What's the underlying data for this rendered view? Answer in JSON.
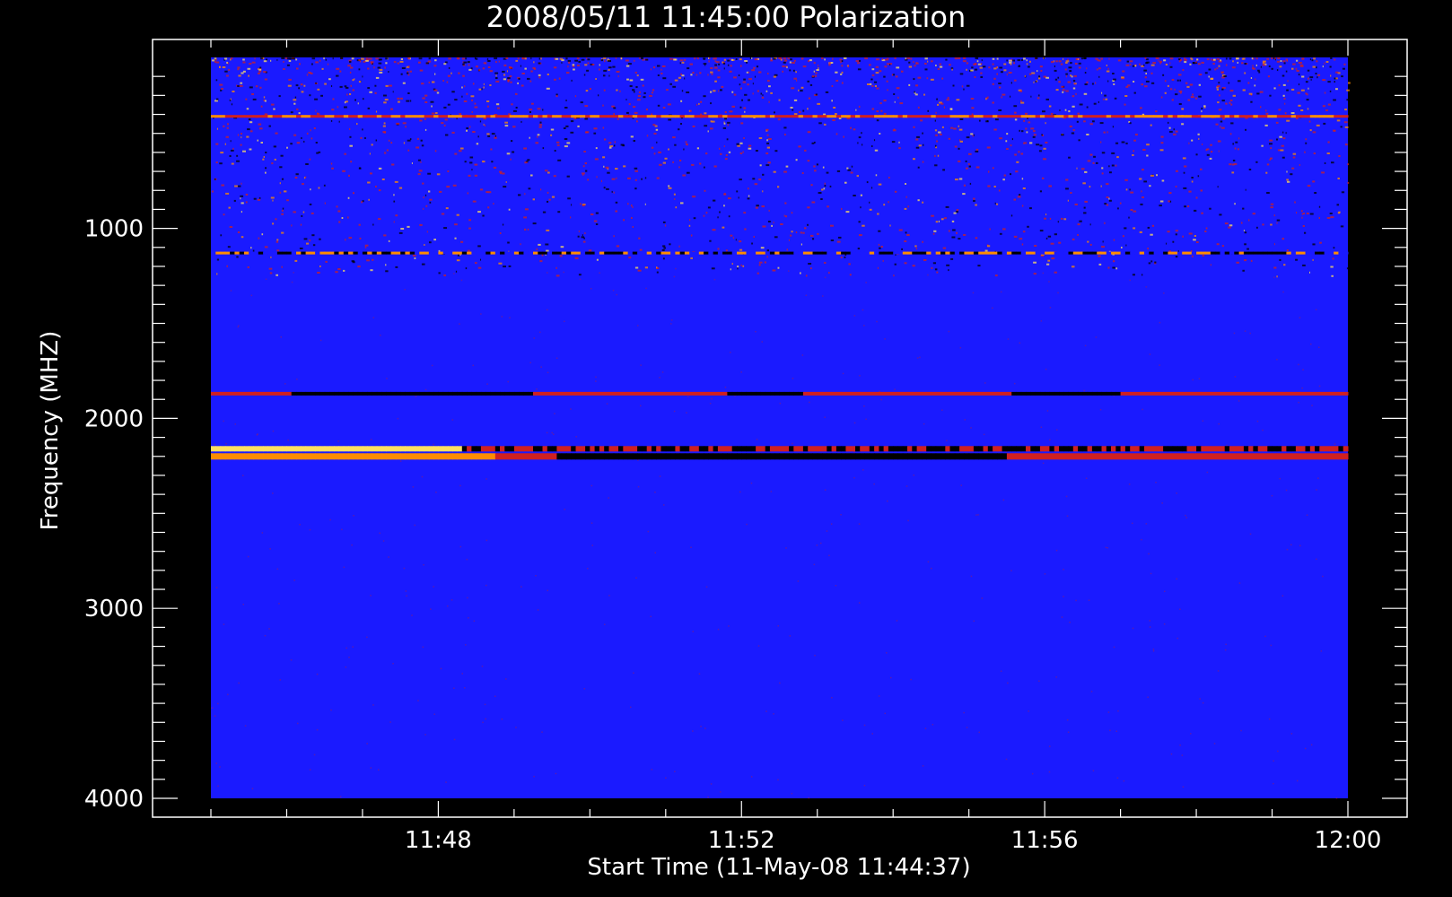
{
  "chart_data": {
    "type": "heatmap",
    "title": "2008/05/11 11:45:00 Polarization",
    "xlabel": "Start Time (11-May-08 11:44:37)",
    "ylabel": "Frequency (MHZ)",
    "xlim": [
      "11:45:00",
      "12:00:00"
    ],
    "ylim": [
      100,
      4000
    ],
    "y_axis_inverted": true,
    "x_tick_labels": [
      "11:48",
      "11:52",
      "11:56",
      "12:00"
    ],
    "y_tick_labels": [
      "1000",
      "2000",
      "3000",
      "4000"
    ],
    "background_color": "#1a1aff",
    "colormap": [
      "#000000",
      "#1a1aff",
      "#d02020",
      "#ff8c00",
      "#ffe060"
    ],
    "features": [
      {
        "description": "strong yellow-red band at start fading to dark band",
        "freq_mhz": [
          2160,
          2210
        ],
        "time": [
          "11:45:00",
          "12:00:00"
        ]
      },
      {
        "description": "thin red/dark line",
        "freq_mhz": 1870,
        "time": [
          "11:45:00",
          "12:00:00"
        ]
      },
      {
        "description": "noisy speckle band",
        "freq_mhz": [
          100,
          1200
        ]
      },
      {
        "description": "bright line",
        "freq_mhz": 410,
        "time": [
          "11:45:00",
          "12:00:00"
        ]
      },
      {
        "description": "speckled line",
        "freq_mhz": 1130,
        "time": [
          "11:45:00",
          "12:00:00"
        ]
      }
    ]
  }
}
